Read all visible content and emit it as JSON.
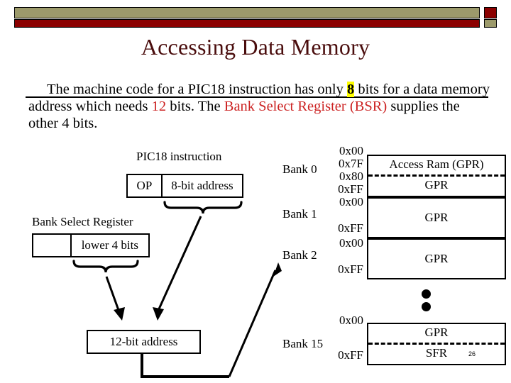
{
  "slide": {
    "title": "Accessing Data Memory",
    "page_number": "26",
    "body": {
      "seg1": "The machine code for a PIC18 instruction has only ",
      "highlight_8": "8",
      "seg2": " bits for a data memory address which needs ",
      "red_12": "12",
      "seg3": " bits. The ",
      "red_bank_select": "Bank Select Register (BSR)",
      "seg4": " supplies the other 4 bits."
    }
  },
  "diagram": {
    "instruction_label": "PIC18 instruction",
    "instruction_box": {
      "opcode": "OP",
      "address": "8-bit address"
    },
    "bsr_label": "Bank Select Register",
    "bsr_box": {
      "upper": "",
      "lower": "lower 4 bits"
    },
    "result_box": "12-bit address",
    "memory": {
      "banks": [
        {
          "name": "Bank 0",
          "addresses": [
            "0x00",
            "0x7F",
            "0x80",
            "0xFF"
          ],
          "segments": [
            "Access Ram (GPR)",
            "GPR"
          ],
          "dashed_split": true
        },
        {
          "name": "Bank 1",
          "addresses": [
            "0x00",
            "0xFF"
          ],
          "segments": [
            "GPR"
          ],
          "dashed_split": false
        },
        {
          "name": "Bank 2",
          "addresses": [
            "0x00",
            "0xFF"
          ],
          "segments": [
            "GPR"
          ],
          "dashed_split": false
        },
        {
          "name": "Bank 15",
          "addresses": [
            "0x00",
            "0xFF"
          ],
          "segments": [
            "GPR",
            "SFR"
          ],
          "dashed_split": true
        }
      ]
    }
  },
  "colors": {
    "title": "#4a0d0d",
    "banner_olive": "#9c9a6b",
    "banner_red": "#8b0000",
    "accent_red": "#cc2222",
    "highlight": "#ffff00"
  }
}
